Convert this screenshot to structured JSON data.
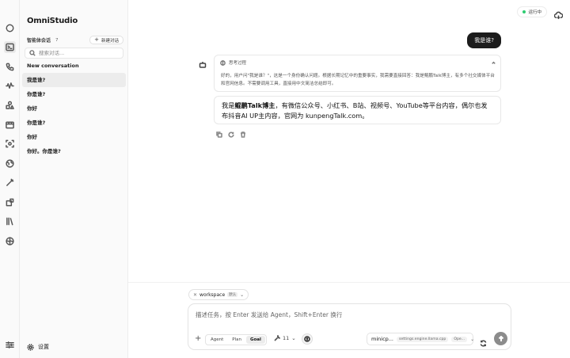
{
  "app": {
    "title": "OmniStudio"
  },
  "rail": {
    "icons": [
      "compass-icon",
      "terminal-icon",
      "phone-icon",
      "waveform-icon",
      "shapes-icon",
      "media-icon",
      "scan-icon",
      "globe-icon",
      "wand-icon",
      "puzzle-icon",
      "library-icon",
      "compass-alt-icon",
      "sliders-icon"
    ],
    "active": "terminal-icon"
  },
  "sidebar": {
    "section_title": "智能体会话",
    "section_count": "7",
    "new_chat_label": "新建对话",
    "search_placeholder": "搜索对话...",
    "conversations": [
      {
        "label": "New conversation",
        "active": false
      },
      {
        "label": "我是谁?",
        "active": true
      },
      {
        "label": "你是谁?",
        "active": false
      },
      {
        "label": "你好",
        "active": false
      },
      {
        "label": "你是谁?",
        "active": false
      },
      {
        "label": "你好",
        "active": false
      },
      {
        "label": "你好。你是谁?",
        "active": false
      }
    ],
    "settings_label": "设置"
  },
  "header": {
    "status_label": "运行中",
    "status_color": "#2ecc71"
  },
  "chat": {
    "user_message": "我是谁?",
    "thinking_title": "思考过程",
    "thinking_text": "好的，用户问\"我是谁？\"，这是一个身份确认问题。根据长期记忆中的重要事实，我需要直接回答：我是鲲鹏Talk博主，有多个社交媒体平台和官网信息。不需要调用工具，直接用中文简洁总结即可。",
    "answer_prefix": "我是",
    "answer_bold": "鲲鹏Talk博主",
    "answer_rest": "，有微信公众号、小红书、B站、视频号、YouTube等平台内容，偶尔也发布抖音AI UP主内容，官网为 kunpengTalk.com。"
  },
  "composer": {
    "workspace_label": "workspace",
    "workspace_tag": "默认",
    "placeholder": "描述任务，按 Enter 发送给 Agent，Shift+Enter 换行",
    "modes": [
      "Agent",
      "Plan",
      "Goal"
    ],
    "active_mode": "Goal",
    "tool_count": "11",
    "model_name": "minicp...",
    "model_detail": "settings.engine.llama.cpp",
    "model_suffix": "Ope..."
  },
  "colors": {
    "accent_dark": "#1c1c1c",
    "send_button": "#8c8c8c"
  }
}
